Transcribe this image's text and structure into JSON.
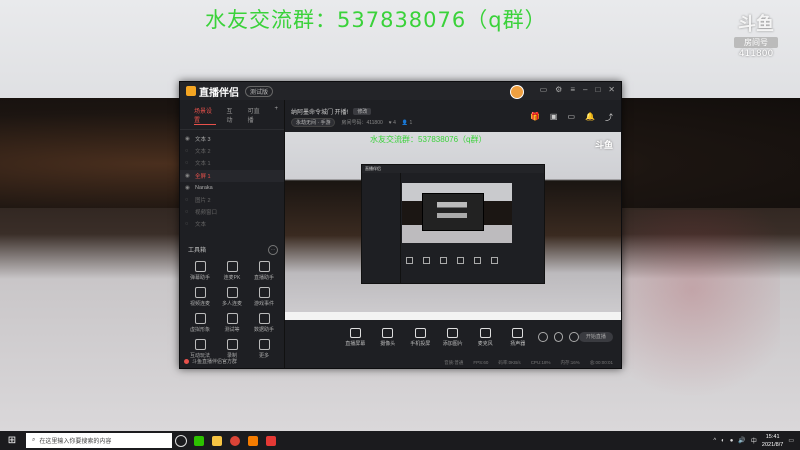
{
  "overlay": {
    "fan_group": "水友交流群：537838076（q群）",
    "brand_mark": "斗鱼",
    "brand_sub": "房间号",
    "room_id": "411800"
  },
  "app": {
    "name": "直播伴侣",
    "version_badge": "测试版",
    "left_tabs": [
      "场景设置",
      "互动",
      "可直播"
    ],
    "scenes": [
      {
        "label": "文本 3",
        "state": "vis"
      },
      {
        "label": "文本 2",
        "state": "dim"
      },
      {
        "label": "文本 1",
        "state": "dim"
      },
      {
        "label": "全屏 1",
        "state": "sel"
      },
      {
        "label": "Naraka",
        "state": "vis"
      },
      {
        "label": "图片 2",
        "state": "dim"
      },
      {
        "label": "视频窗口",
        "state": "dim"
      },
      {
        "label": "文本",
        "state": "dim"
      }
    ],
    "toolbox_title": "工具箱",
    "tools": [
      "弹幕助手",
      "连麦PK",
      "直播助手",
      "视频连麦",
      "多人连麦",
      "游戏事件",
      "虚拟形象",
      "测试等",
      "数据助手",
      "互动玩法",
      "录制",
      "更多"
    ],
    "left_footer": "斗鱼直播伴侣官方群"
  },
  "room": {
    "title": "纳阿墨命令城门 开播!",
    "edit_label": "修改",
    "category": "永劫无间 · 手游",
    "room_id_label": "房间号码：411800",
    "likes": "4",
    "viewers": "1"
  },
  "preview": {
    "fan_group": "水友交流群：537838076（q群）",
    "logo": "斗鱼"
  },
  "controls": [
    {
      "label": "直播屏幕",
      "icon": "monitor-icon"
    },
    {
      "label": "摄像头",
      "icon": "camera-icon"
    },
    {
      "label": "手机投屏",
      "icon": "phone-cast-icon"
    },
    {
      "label": "添加图片",
      "icon": "image-add-icon"
    },
    {
      "label": "麦克风",
      "icon": "microphone-icon"
    },
    {
      "label": "扬声器",
      "icon": "speaker-icon"
    }
  ],
  "start_label": "开始直播",
  "status": [
    "音质:普通",
    "FPS:60",
    "码率:0KB/s",
    "CPU:18%",
    "内存:16%",
    "总:00:00:01"
  ],
  "taskbar": {
    "search_placeholder": "在这里输入你要搜索的内容",
    "time": "15:41",
    "date": "2021/8/7"
  }
}
